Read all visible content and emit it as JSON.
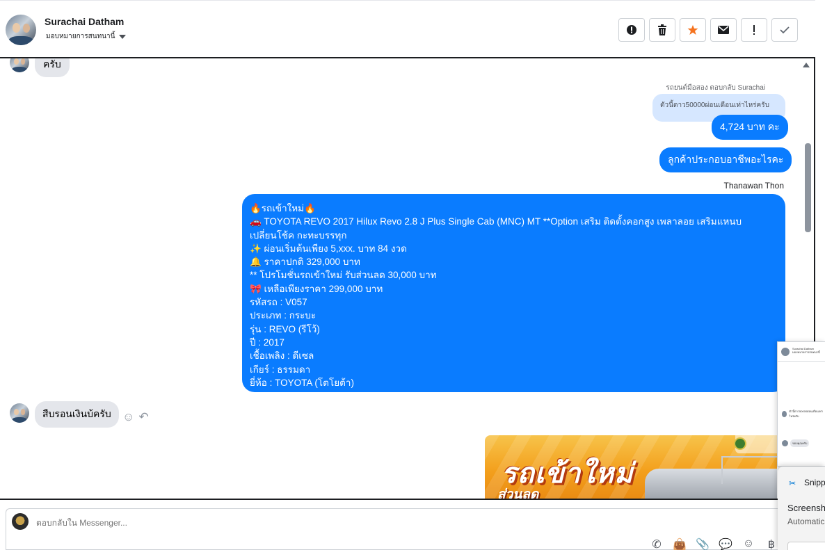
{
  "header": {
    "contact_name": "Surachai Datham",
    "assign_label": "มอบหมายการสนทนานี้",
    "actions": [
      {
        "icon": "alert-circle-icon",
        "glyph": "!"
      },
      {
        "icon": "trash-icon",
        "glyph": "🗑"
      },
      {
        "icon": "star-icon",
        "glyph": "★"
      },
      {
        "icon": "envelope-icon",
        "glyph": "✉"
      },
      {
        "icon": "exclamation-icon",
        "glyph": "!"
      },
      {
        "icon": "checkmark-icon",
        "glyph": "✓"
      }
    ]
  },
  "messages": {
    "top_incoming": "ครับ",
    "reply_context": "รถยนต์มือสอง ตอบกลับ Surachai",
    "reply_quote": "ตัวนี้ดาว50000ผ่อนเดือนเท่าไหร่ครับ",
    "out_price": "4,724 บาท คะ",
    "out_question": "ลูกค้าประกอบอาชีพอะไรคะ",
    "sender_name": "Thanawan Thon",
    "big_message_lines": [
      "🔥รถเข้าใหม่🔥",
      "🚗  TOYOTA REVO 2017 Hilux Revo 2.8 J Plus Single Cab (MNC) MT **Option เสริม ติดตั้งคอกสูง เพลาลอย เสริมแหนบ",
      "เปลี่ยนโช้ค กะทะบรรทุก",
      "✨  ผ่อนเริ่มต้นเพียง 5,xxx. บาท 84 งวด",
      "🔔   ราคาปกติ 329,000 บาท",
      "** โปรโมชั่นรถเข้าใหม่ รับส่วนลด 30,000 บาท",
      "🎀  เหลือเพียงราคา 299,000 บาท",
      "   รหัสรถ : V057",
      "   ประเภท : กระบะ",
      "   รุ่น : REVO (รีโว้)",
      "   ปี : 2017",
      "   เชื้อเพลิง : ดีเซล",
      "   เกียร์ : ธรรมดา",
      "   ยี่ห้อ : TOYOTA (โตโยต้า)"
    ],
    "incoming_last": "สืบรอนเงินบ้ครับ",
    "promo_title": "รถเข้าใหม่",
    "promo_sub": "ส่วนลด"
  },
  "composer": {
    "placeholder": "ตอบกลับใน Messenger..."
  },
  "mini_chat": {
    "title_line1": "Surachai Datham",
    "title_line2": "มอบหมายการสนทนานี้",
    "row1": "ตัวนี้ดาว50000ผ่อนเดือนเท่าไหร่ครับ",
    "row2": "ขอบคุณครับ"
  },
  "snipping": {
    "title": "Snipping Tool",
    "line1": "Screenshot copied",
    "line2": "Automatically saved"
  }
}
